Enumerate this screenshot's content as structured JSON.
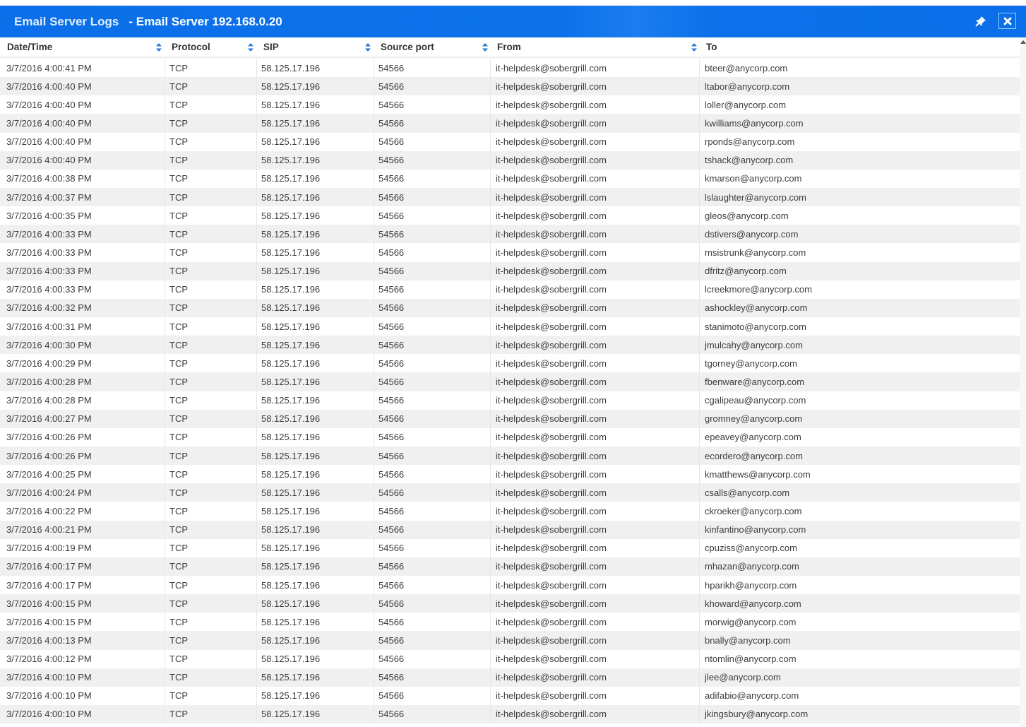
{
  "window": {
    "title": "Email Server Logs",
    "subtitle": "- Email Server 192.168.0.20",
    "pin_icon": "pin-icon",
    "close_icon": "close-icon",
    "brand_color": "#0a6fe8"
  },
  "table": {
    "columns": [
      {
        "key": "datetime",
        "label": "Date/Time",
        "sortable": true
      },
      {
        "key": "protocol",
        "label": "Protocol",
        "sortable": true
      },
      {
        "key": "sip",
        "label": "SIP",
        "sortable": true
      },
      {
        "key": "source_port",
        "label": "Source port",
        "sortable": true
      },
      {
        "key": "from",
        "label": "From",
        "sortable": true
      },
      {
        "key": "to",
        "label": "To",
        "sortable": false
      }
    ],
    "rows": [
      {
        "datetime": "3/7/2016 4:00:41 PM",
        "protocol": "TCP",
        "sip": "58.125.17.196",
        "source_port": "54566",
        "from": "it-helpdesk@sobergrill.com",
        "to": "bteer@anycorp.com"
      },
      {
        "datetime": "3/7/2016 4:00:40 PM",
        "protocol": "TCP",
        "sip": "58.125.17.196",
        "source_port": "54566",
        "from": "it-helpdesk@sobergrill.com",
        "to": "ltabor@anycorp.com"
      },
      {
        "datetime": "3/7/2016 4:00:40 PM",
        "protocol": "TCP",
        "sip": "58.125.17.196",
        "source_port": "54566",
        "from": "it-helpdesk@sobergrill.com",
        "to": "loller@anycorp.com"
      },
      {
        "datetime": "3/7/2016 4:00:40 PM",
        "protocol": "TCP",
        "sip": "58.125.17.196",
        "source_port": "54566",
        "from": "it-helpdesk@sobergrill.com",
        "to": "kwilliams@anycorp.com"
      },
      {
        "datetime": "3/7/2016 4:00:40 PM",
        "protocol": "TCP",
        "sip": "58.125.17.196",
        "source_port": "54566",
        "from": "it-helpdesk@sobergrill.com",
        "to": "rponds@anycorp.com"
      },
      {
        "datetime": "3/7/2016 4:00:40 PM",
        "protocol": "TCP",
        "sip": "58.125.17.196",
        "source_port": "54566",
        "from": "it-helpdesk@sobergrill.com",
        "to": "tshack@anycorp.com"
      },
      {
        "datetime": "3/7/2016 4:00:38 PM",
        "protocol": "TCP",
        "sip": "58.125.17.196",
        "source_port": "54566",
        "from": "it-helpdesk@sobergrill.com",
        "to": "kmarson@anycorp.com"
      },
      {
        "datetime": "3/7/2016 4:00:37 PM",
        "protocol": "TCP",
        "sip": "58.125.17.196",
        "source_port": "54566",
        "from": "it-helpdesk@sobergrill.com",
        "to": "lslaughter@anycorp.com"
      },
      {
        "datetime": "3/7/2016 4:00:35 PM",
        "protocol": "TCP",
        "sip": "58.125.17.196",
        "source_port": "54566",
        "from": "it-helpdesk@sobergrill.com",
        "to": "gleos@anycorp.com"
      },
      {
        "datetime": "3/7/2016 4:00:33 PM",
        "protocol": "TCP",
        "sip": "58.125.17.196",
        "source_port": "54566",
        "from": "it-helpdesk@sobergrill.com",
        "to": "dstivers@anycorp.com"
      },
      {
        "datetime": "3/7/2016 4:00:33 PM",
        "protocol": "TCP",
        "sip": "58.125.17.196",
        "source_port": "54566",
        "from": "it-helpdesk@sobergrill.com",
        "to": "msistrunk@anycorp.com"
      },
      {
        "datetime": "3/7/2016 4:00:33 PM",
        "protocol": "TCP",
        "sip": "58.125.17.196",
        "source_port": "54566",
        "from": "it-helpdesk@sobergrill.com",
        "to": "dfritz@anycorp.com"
      },
      {
        "datetime": "3/7/2016 4:00:33 PM",
        "protocol": "TCP",
        "sip": "58.125.17.196",
        "source_port": "54566",
        "from": "it-helpdesk@sobergrill.com",
        "to": "lcreekmore@anycorp.com"
      },
      {
        "datetime": "3/7/2016 4:00:32 PM",
        "protocol": "TCP",
        "sip": "58.125.17.196",
        "source_port": "54566",
        "from": "it-helpdesk@sobergrill.com",
        "to": "ashockley@anycorp.com"
      },
      {
        "datetime": "3/7/2016 4:00:31 PM",
        "protocol": "TCP",
        "sip": "58.125.17.196",
        "source_port": "54566",
        "from": "it-helpdesk@sobergrill.com",
        "to": "stanimoto@anycorp.com"
      },
      {
        "datetime": "3/7/2016 4:00:30 PM",
        "protocol": "TCP",
        "sip": "58.125.17.196",
        "source_port": "54566",
        "from": "it-helpdesk@sobergrill.com",
        "to": "jmulcahy@anycorp.com"
      },
      {
        "datetime": "3/7/2016 4:00:29 PM",
        "protocol": "TCP",
        "sip": "58.125.17.196",
        "source_port": "54566",
        "from": "it-helpdesk@sobergrill.com",
        "to": "tgorney@anycorp.com"
      },
      {
        "datetime": "3/7/2016 4:00:28 PM",
        "protocol": "TCP",
        "sip": "58.125.17.196",
        "source_port": "54566",
        "from": "it-helpdesk@sobergrill.com",
        "to": "fbenware@anycorp.com"
      },
      {
        "datetime": "3/7/2016 4:00:28 PM",
        "protocol": "TCP",
        "sip": "58.125.17.196",
        "source_port": "54566",
        "from": "it-helpdesk@sobergrill.com",
        "to": "cgalipeau@anycorp.com"
      },
      {
        "datetime": "3/7/2016 4:00:27 PM",
        "protocol": "TCP",
        "sip": "58.125.17.196",
        "source_port": "54566",
        "from": "it-helpdesk@sobergrill.com",
        "to": "gromney@anycorp.com"
      },
      {
        "datetime": "3/7/2016 4:00:26 PM",
        "protocol": "TCP",
        "sip": "58.125.17.196",
        "source_port": "54566",
        "from": "it-helpdesk@sobergrill.com",
        "to": "epeavey@anycorp.com"
      },
      {
        "datetime": "3/7/2016 4:00:26 PM",
        "protocol": "TCP",
        "sip": "58.125.17.196",
        "source_port": "54566",
        "from": "it-helpdesk@sobergrill.com",
        "to": "ecordero@anycorp.com"
      },
      {
        "datetime": "3/7/2016 4:00:25 PM",
        "protocol": "TCP",
        "sip": "58.125.17.196",
        "source_port": "54566",
        "from": "it-helpdesk@sobergrill.com",
        "to": "kmatthews@anycorp.com"
      },
      {
        "datetime": "3/7/2016 4:00:24 PM",
        "protocol": "TCP",
        "sip": "58.125.17.196",
        "source_port": "54566",
        "from": "it-helpdesk@sobergrill.com",
        "to": "csalls@anycorp.com"
      },
      {
        "datetime": "3/7/2016 4:00:22 PM",
        "protocol": "TCP",
        "sip": "58.125.17.196",
        "source_port": "54566",
        "from": "it-helpdesk@sobergrill.com",
        "to": "ckroeker@anycorp.com"
      },
      {
        "datetime": "3/7/2016 4:00:21 PM",
        "protocol": "TCP",
        "sip": "58.125.17.196",
        "source_port": "54566",
        "from": "it-helpdesk@sobergrill.com",
        "to": "kinfantino@anycorp.com"
      },
      {
        "datetime": "3/7/2016 4:00:19 PM",
        "protocol": "TCP",
        "sip": "58.125.17.196",
        "source_port": "54566",
        "from": "it-helpdesk@sobergrill.com",
        "to": "cpuziss@anycorp.com"
      },
      {
        "datetime": "3/7/2016 4:00:17 PM",
        "protocol": "TCP",
        "sip": "58.125.17.196",
        "source_port": "54566",
        "from": "it-helpdesk@sobergrill.com",
        "to": "mhazan@anycorp.com"
      },
      {
        "datetime": "3/7/2016 4:00:17 PM",
        "protocol": "TCP",
        "sip": "58.125.17.196",
        "source_port": "54566",
        "from": "it-helpdesk@sobergrill.com",
        "to": "hparikh@anycorp.com"
      },
      {
        "datetime": "3/7/2016 4:00:15 PM",
        "protocol": "TCP",
        "sip": "58.125.17.196",
        "source_port": "54566",
        "from": "it-helpdesk@sobergrill.com",
        "to": "khoward@anycorp.com"
      },
      {
        "datetime": "3/7/2016 4:00:15 PM",
        "protocol": "TCP",
        "sip": "58.125.17.196",
        "source_port": "54566",
        "from": "it-helpdesk@sobergrill.com",
        "to": "morwig@anycorp.com"
      },
      {
        "datetime": "3/7/2016 4:00:13 PM",
        "protocol": "TCP",
        "sip": "58.125.17.196",
        "source_port": "54566",
        "from": "it-helpdesk@sobergrill.com",
        "to": "bnally@anycorp.com"
      },
      {
        "datetime": "3/7/2016 4:00:12 PM",
        "protocol": "TCP",
        "sip": "58.125.17.196",
        "source_port": "54566",
        "from": "it-helpdesk@sobergrill.com",
        "to": "ntomlin@anycorp.com"
      },
      {
        "datetime": "3/7/2016 4:00:10 PM",
        "protocol": "TCP",
        "sip": "58.125.17.196",
        "source_port": "54566",
        "from": "it-helpdesk@sobergrill.com",
        "to": "jlee@anycorp.com"
      },
      {
        "datetime": "3/7/2016 4:00:10 PM",
        "protocol": "TCP",
        "sip": "58.125.17.196",
        "source_port": "54566",
        "from": "it-helpdesk@sobergrill.com",
        "to": "adifabio@anycorp.com"
      },
      {
        "datetime": "3/7/2016 4:00:10 PM",
        "protocol": "TCP",
        "sip": "58.125.17.196",
        "source_port": "54566",
        "from": "it-helpdesk@sobergrill.com",
        "to": "jkingsbury@anycorp.com"
      }
    ]
  }
}
